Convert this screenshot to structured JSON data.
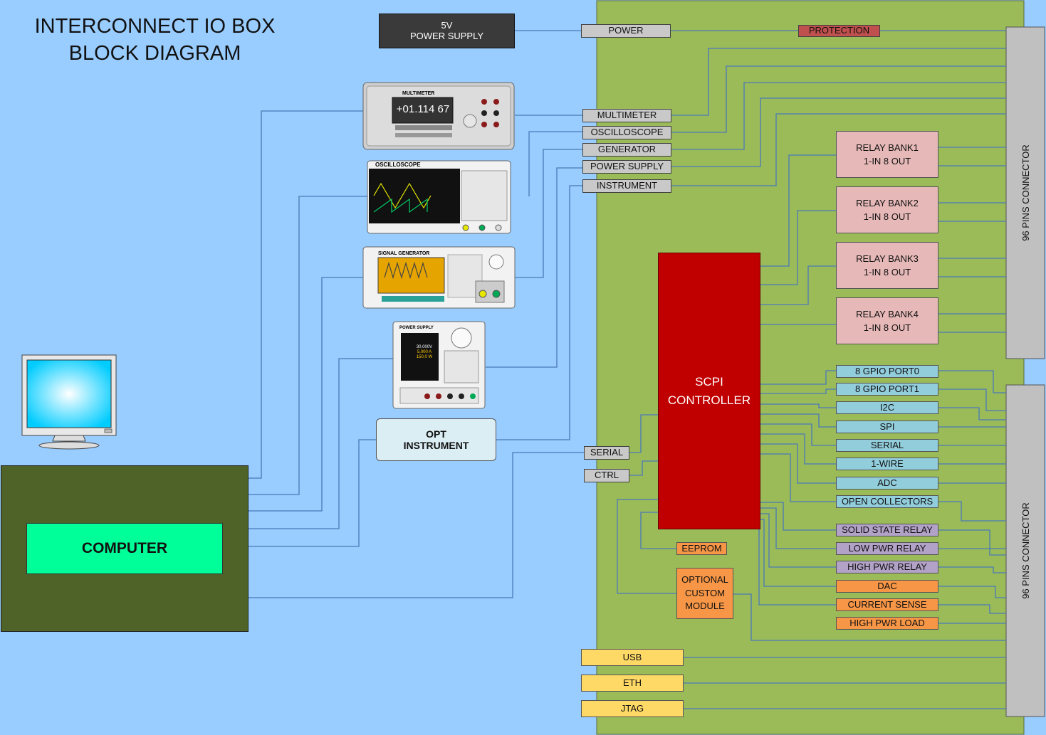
{
  "title_line1": "INTERCONNECT IO BOX",
  "title_line2": "BLOCK DIAGRAM",
  "supply": "5V\nPOWER SUPPLY",
  "power": "POWER",
  "protection": "PROTECTION",
  "instruments": {
    "multimeter": "MULTIMETER",
    "oscilloscope": "OSCILLOSCOPE",
    "generator": "GENERATOR",
    "power_supply": "POWER SUPPLY",
    "instrument": "INSTRUMENT"
  },
  "dmm_title": "MULTIMETER",
  "dmm_reading": "+01.114 67",
  "scope_title": "OSCILLOSCOPE",
  "siggen_title": "SIGNAL GENERATOR",
  "psu_title": "POWER SUPPLY",
  "psu_readout": [
    "30.000V",
    "5.000 A",
    "150.0 W"
  ],
  "opt_instrument": "OPT\nINSTRUMENT",
  "computer": "COMPUTER",
  "controller": "SCPI\nCONTROLLER",
  "serial": "SERIAL",
  "ctrl": "CTRL",
  "eeprom": "EEPROM",
  "optional_module": "OPTIONAL\nCUSTOM\nMODULE",
  "relay_banks": [
    "RELAY BANK1\n1-IN 8 OUT",
    "RELAY BANK2\n1-IN 8 OUT",
    "RELAY BANK3\n1-IN 8 OUT",
    "RELAY BANK4\n1-IN 8 OUT"
  ],
  "io_ports": [
    "8 GPIO PORT0",
    "8 GPIO PORT1",
    "I2C",
    "SPI",
    "SERIAL",
    "1-WIRE",
    "ADC",
    "OPEN COLLECTORS"
  ],
  "relays": [
    "SOLID STATE RELAY",
    "LOW PWR RELAY",
    "HIGH PWR RELAY"
  ],
  "outputs": [
    "DAC",
    "CURRENT SENSE",
    "HIGH PWR LOAD"
  ],
  "interfaces": [
    "USB",
    "ETH",
    "JTAG"
  ],
  "connectors": [
    "96 PINS CONNECTOR",
    "96 PINS CONNECTOR"
  ],
  "colors": {
    "background": "#99ccff",
    "board": "#9bbb59",
    "controller": "#c00000",
    "computer_case": "#4f6228",
    "computer_label": "#00ff99",
    "relay_bank": "#e6b9b8",
    "io_port": "#92cddc",
    "relay": "#b3a2c7",
    "output": "#f79646",
    "interface": "#ffd966",
    "label": "#c9c9c9",
    "protection": "#c0504d",
    "wire": "#4a7ab8"
  }
}
